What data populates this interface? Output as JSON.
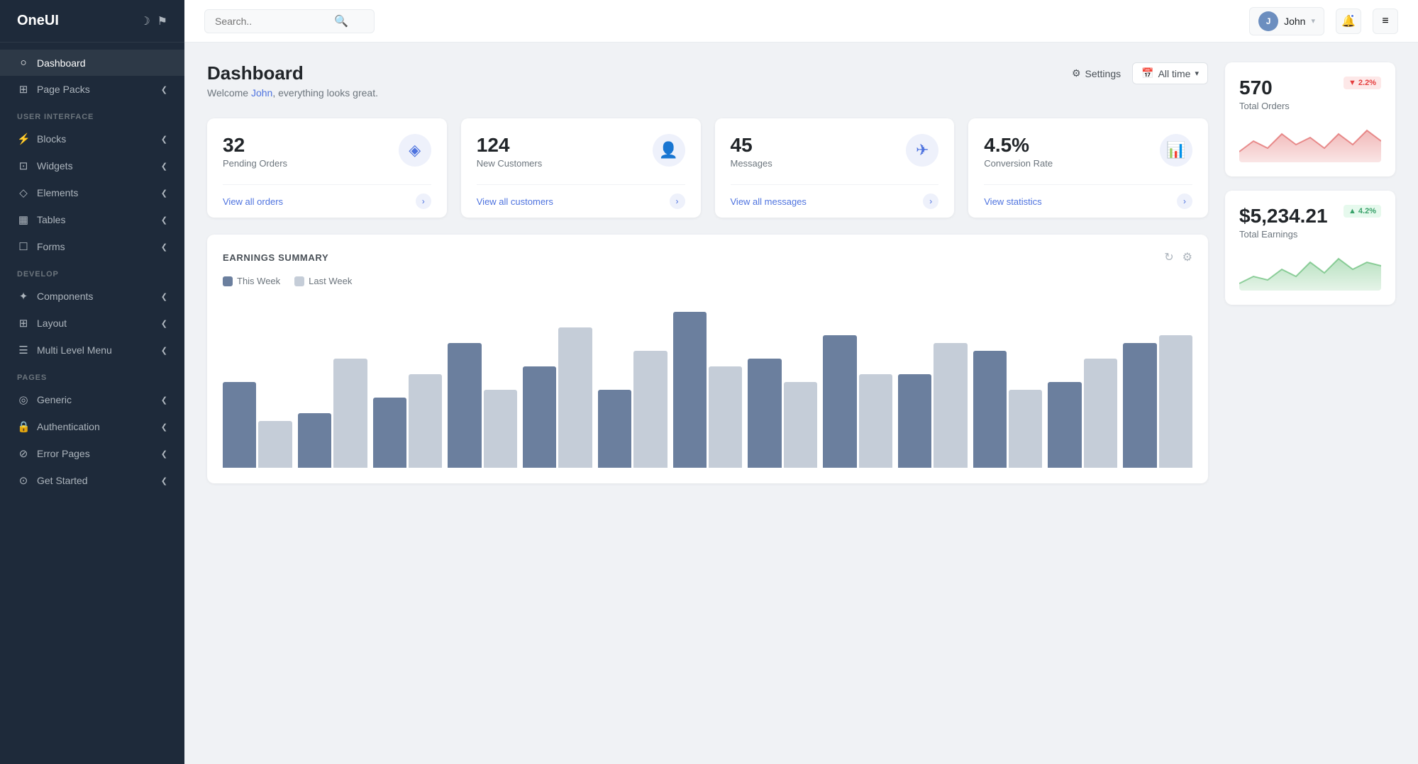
{
  "app": {
    "name": "OneUI"
  },
  "sidebar": {
    "logo": "OneUI",
    "items": [
      {
        "id": "dashboard",
        "label": "Dashboard",
        "icon": "○",
        "active": true,
        "hasChevron": false
      },
      {
        "id": "page-packs",
        "label": "Page Packs",
        "icon": "⊞",
        "active": false,
        "hasChevron": true
      }
    ],
    "sections": [
      {
        "label": "USER INTERFACE",
        "items": [
          {
            "id": "blocks",
            "label": "Blocks",
            "icon": "⚡",
            "hasChevron": true
          },
          {
            "id": "widgets",
            "label": "Widgets",
            "icon": "⊡",
            "hasChevron": true
          },
          {
            "id": "elements",
            "label": "Elements",
            "icon": "◇",
            "hasChevron": true
          },
          {
            "id": "tables",
            "label": "Tables",
            "icon": "▦",
            "hasChevron": true
          },
          {
            "id": "forms",
            "label": "Forms",
            "icon": "☐",
            "hasChevron": true
          }
        ]
      },
      {
        "label": "DEVELOP",
        "items": [
          {
            "id": "components",
            "label": "Components",
            "icon": "✦",
            "hasChevron": true
          },
          {
            "id": "layout",
            "label": "Layout",
            "icon": "⊞",
            "hasChevron": true
          },
          {
            "id": "multi-level-menu",
            "label": "Multi Level Menu",
            "icon": "☰",
            "hasChevron": true
          }
        ]
      },
      {
        "label": "PAGES",
        "items": [
          {
            "id": "generic",
            "label": "Generic",
            "icon": "◎",
            "hasChevron": true
          },
          {
            "id": "authentication",
            "label": "Authentication",
            "icon": "🔒",
            "hasChevron": true
          },
          {
            "id": "error-pages",
            "label": "Error Pages",
            "icon": "⊘",
            "hasChevron": true
          },
          {
            "id": "get-started",
            "label": "Get Started",
            "icon": "⊙",
            "hasChevron": true
          }
        ]
      }
    ]
  },
  "topbar": {
    "search_placeholder": "Search..",
    "user_name": "John",
    "menu_label": "≡"
  },
  "page": {
    "title": "Dashboard",
    "subtitle_prefix": "Welcome ",
    "username": "John",
    "subtitle_suffix": ", everything looks great.",
    "settings_label": "Settings",
    "alltime_label": "All time"
  },
  "stat_cards": [
    {
      "number": "32",
      "label": "Pending Orders",
      "link": "View all orders",
      "icon": "◈"
    },
    {
      "number": "124",
      "label": "New Customers",
      "link": "View all customers",
      "icon": "👤"
    },
    {
      "number": "45",
      "label": "Messages",
      "link": "View all messages",
      "icon": "✈"
    },
    {
      "number": "4.5%",
      "label": "Conversion Rate",
      "link": "View statistics",
      "icon": "📊"
    }
  ],
  "earnings_chart": {
    "title": "EARNINGS SUMMARY",
    "legend": {
      "this_week": "This Week",
      "last_week": "Last Week"
    },
    "bars": [
      {
        "this": 55,
        "last": 30
      },
      {
        "this": 35,
        "last": 70
      },
      {
        "this": 45,
        "last": 60
      },
      {
        "this": 80,
        "last": 50
      },
      {
        "this": 65,
        "last": 90
      },
      {
        "this": 50,
        "last": 75
      },
      {
        "this": 100,
        "last": 65
      },
      {
        "this": 70,
        "last": 55
      },
      {
        "this": 85,
        "last": 60
      },
      {
        "this": 60,
        "last": 80
      },
      {
        "this": 75,
        "last": 50
      },
      {
        "this": 55,
        "last": 70
      },
      {
        "this": 80,
        "last": 85
      }
    ]
  },
  "side_cards": [
    {
      "number": "570",
      "label": "Total Orders",
      "badge": "▼ 2.2%",
      "badge_type": "down",
      "chart_color_fill": "rgba(220,80,80,0.15)",
      "chart_color_stroke": "rgba(220,80,80,0.6)"
    },
    {
      "number": "$5,234.21",
      "label": "Total Earnings",
      "badge": "▲ 4.2%",
      "badge_type": "up",
      "chart_color_fill": "rgba(80,180,100,0.15)",
      "chart_color_stroke": "rgba(80,180,100,0.6)"
    }
  ]
}
